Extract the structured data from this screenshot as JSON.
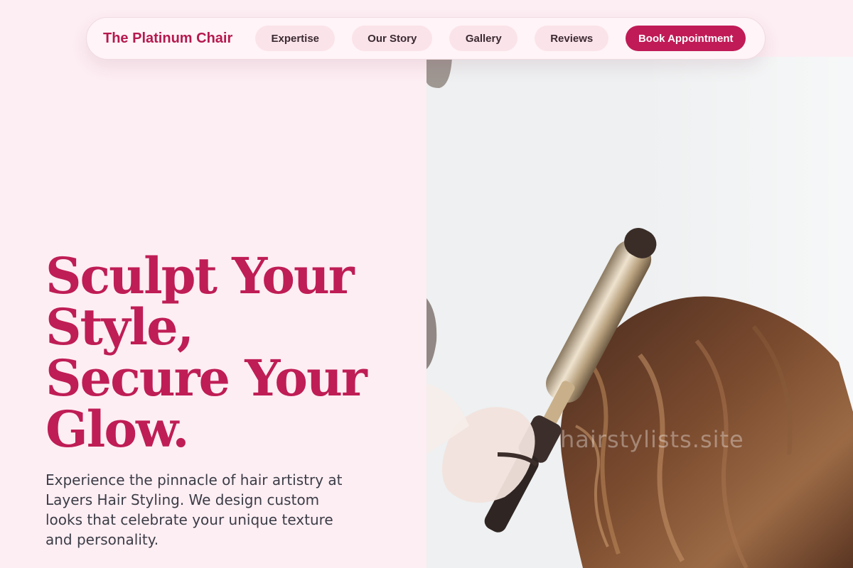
{
  "nav": {
    "brand": "The Platinum Chair",
    "items": [
      {
        "label": "Expertise"
      },
      {
        "label": "Our Story"
      },
      {
        "label": "Gallery"
      },
      {
        "label": "Reviews"
      }
    ],
    "cta_label": "Book Appointment"
  },
  "hero": {
    "title_lines": [
      "Sculpt Your",
      "Style,",
      "Secure Your",
      "Glow."
    ],
    "subtitle": "Experience the pinnacle of hair artistry at Layers Hair Styling. We design custom looks that celebrate your unique texture and personality."
  },
  "image": {
    "watermark": "hairstylists.site"
  },
  "colors": {
    "accent": "#c01b56",
    "background": "#fdeef3",
    "nav_pill": "#fbe3ea",
    "text_dark": "#3c3c46"
  }
}
